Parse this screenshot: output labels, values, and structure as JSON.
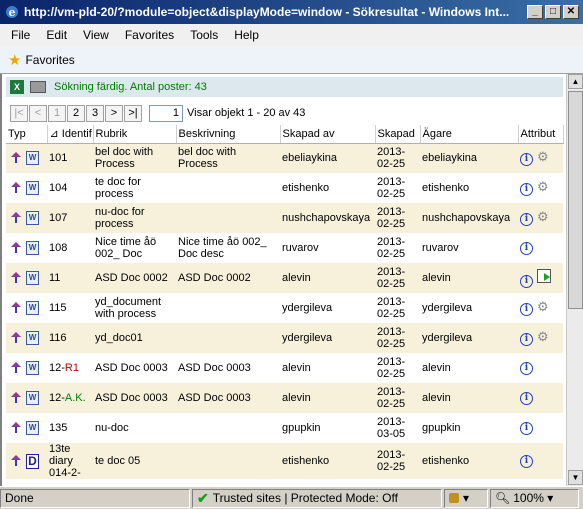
{
  "window": {
    "title": "http://vm-pld-20/?module=object&displayMode=window - Sökresultat - Windows Int..."
  },
  "menu": [
    "File",
    "Edit",
    "View",
    "Favorites",
    "Tools",
    "Help"
  ],
  "favorites_label": "Favorites",
  "search_status": "Sökning färdig. Antal poster: 43",
  "pager": {
    "buttons": [
      "|<",
      "<",
      "1",
      "2",
      "3",
      ">",
      ">|"
    ],
    "current_page": "1",
    "summary": "Visar objekt 1 - 20 av 43"
  },
  "columns": [
    "Typ",
    "Identif",
    "Rubrik",
    "Beskrivning",
    "Skapad av",
    "Skapad",
    "Ägare",
    "Attribut"
  ],
  "rows": [
    {
      "id": "101",
      "rubrik": "bel doc with Process",
      "beskrivning": "bel doc with Process",
      "skapad_av": "ebeliaykina",
      "skapad": "2013-02-25",
      "agare": "ebeliaykina",
      "icon": "word-doc-icon",
      "attr": "gear"
    },
    {
      "id": "104",
      "rubrik": "te doc for process",
      "beskrivning": "",
      "skapad_av": "etishenko",
      "skapad": "2013-02-25",
      "agare": "etishenko",
      "icon": "word-doc-icon",
      "attr": "gear"
    },
    {
      "id": "107",
      "rubrik": "nu-doc for process",
      "beskrivning": "",
      "skapad_av": "nushchapovskaya",
      "skapad": "2013-02-25",
      "agare": "nushchapovskaya",
      "icon": "word-doc-icon",
      "attr": "gear"
    },
    {
      "id": "108",
      "rubrik": "Nice time åö 002_ Doc",
      "beskrivning": "Nice time åö 002_ Doc desc",
      "skapad_av": "ruvarov",
      "skapad": "2013-02-25",
      "agare": "ruvarov",
      "icon": "word-doc-icon",
      "attr": ""
    },
    {
      "id": "11",
      "rubrik": "ASD Doc 0002",
      "beskrivning": "ASD Doc 0002",
      "skapad_av": "alevin",
      "skapad": "2013-02-25",
      "agare": "alevin",
      "icon": "word-doc-icon",
      "attr": "process"
    },
    {
      "id": "115",
      "rubrik": "yd_document with process",
      "beskrivning": "",
      "skapad_av": "ydergileva",
      "skapad": "2013-02-25",
      "agare": "ydergileva",
      "icon": "word-doc-icon",
      "attr": "gear"
    },
    {
      "id": "116",
      "rubrik": "yd_doc01",
      "beskrivning": "",
      "skapad_av": "ydergileva",
      "skapad": "2013-02-25",
      "agare": "ydergileva",
      "icon": "word-doc-icon",
      "attr": "gear"
    },
    {
      "id": "12-R1",
      "id_prefix": "12-",
      "id_suffix": "R1",
      "suffix_color": "red",
      "rubrik": "ASD Doc 0003",
      "beskrivning": "ASD Doc 0003",
      "skapad_av": "alevin",
      "skapad": "2013-02-25",
      "agare": "alevin",
      "icon": "word-doc-icon",
      "attr": ""
    },
    {
      "id": "12-A.K.",
      "id_prefix": "12-",
      "id_suffix": "A.K.",
      "suffix_color": "green",
      "rubrik": "ASD Doc 0003",
      "beskrivning": "ASD Doc 0003",
      "skapad_av": "alevin",
      "skapad": "2013-02-25",
      "agare": "alevin",
      "icon": "word-doc-icon",
      "attr": ""
    },
    {
      "id": "135",
      "rubrik": "nu-doc",
      "beskrivning": "",
      "skapad_av": "gpupkin",
      "skapad": "2013-03-05",
      "agare": "gpupkin",
      "icon": "word-doc-icon",
      "attr": ""
    },
    {
      "id": "13te diary 014-2-",
      "rubrik": "te doc 05",
      "beskrivning": "",
      "skapad_av": "etishenko",
      "skapad": "2013-02-25",
      "agare": "etishenko",
      "icon": "diary-icon",
      "attr": ""
    }
  ],
  "statusbar": {
    "left": "Done",
    "zone": "Trusted sites | Protected Mode: Off",
    "zoom": "100%"
  }
}
